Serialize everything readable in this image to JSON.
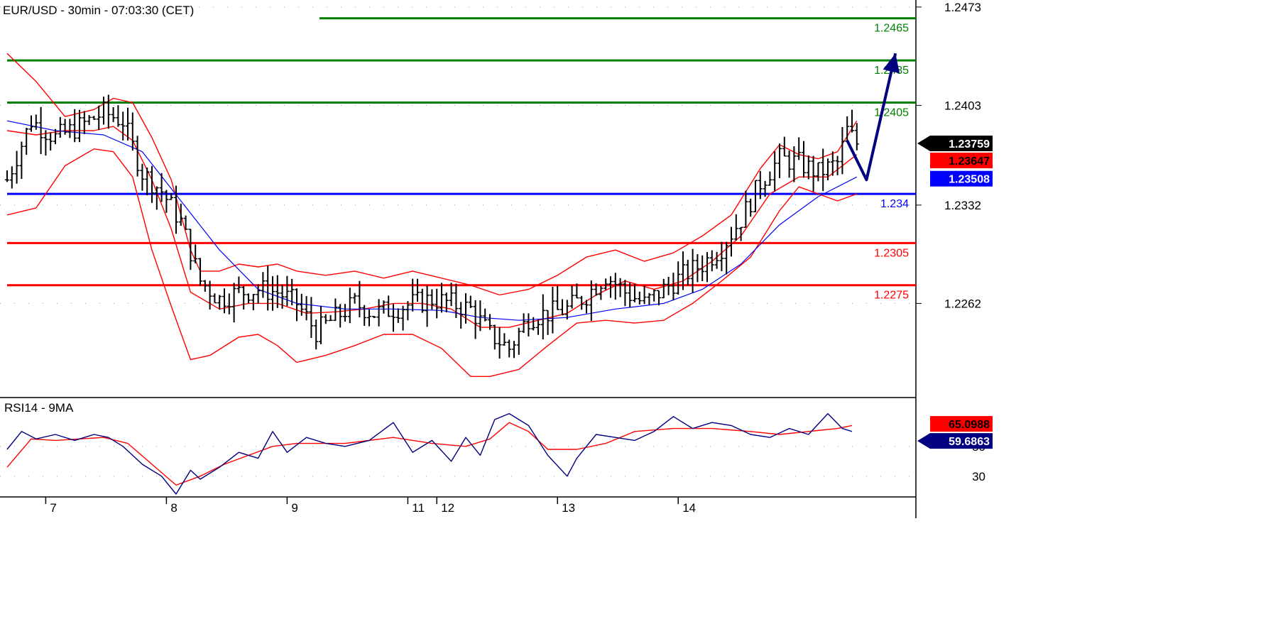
{
  "chart_data": [
    {
      "type": "candlestick",
      "title": "EUR/USD - 30min - 07:03:30 (CET)",
      "ylim": [
        1.2195,
        1.2478
      ],
      "yticks": [
        "1.2473",
        "1.2403",
        "1.2332",
        "1.2262"
      ],
      "x_ticks": [
        "7",
        "8",
        "9",
        "11",
        "12",
        "13",
        "14"
      ],
      "grid": true,
      "horizontal_levels": [
        {
          "value": 1.2465,
          "label": "1.2465",
          "color": "#008000"
        },
        {
          "value": 1.2435,
          "label": "1.2435",
          "color": "#008000"
        },
        {
          "value": 1.2405,
          "label": "1.2405",
          "color": "#008000"
        },
        {
          "value": 1.234,
          "label": "1.234",
          "color": "#0000ff"
        },
        {
          "value": 1.2305,
          "label": "1.2305",
          "color": "#ff0000"
        },
        {
          "value": 1.2275,
          "label": "1.2275",
          "color": "#ff0000"
        }
      ],
      "price_badges": [
        {
          "value": 1.23759,
          "label": "1.23759",
          "bg": "#000000",
          "fg": "#ffffff",
          "pointer": true
        },
        {
          "value": 1.23647,
          "label": "1.23647",
          "bg": "#ff0000",
          "fg": "#000000",
          "pointer": false
        },
        {
          "value": 1.23508,
          "label": "1.23508",
          "bg": "#0000ff",
          "fg": "#ffffff",
          "pointer": false
        }
      ],
      "close_path": [
        [
          0,
          1.235
        ],
        [
          5,
          1.2392
        ],
        [
          10,
          1.238
        ],
        [
          15,
          1.2388
        ],
        [
          20,
          1.2398
        ],
        [
          24,
          1.2392
        ],
        [
          28,
          1.2355
        ],
        [
          32,
          1.2342
        ],
        [
          36,
          1.232
        ],
        [
          40,
          1.2278
        ],
        [
          44,
          1.2265
        ],
        [
          48,
          1.227
        ],
        [
          52,
          1.2272
        ],
        [
          56,
          1.227
        ],
        [
          60,
          1.2262
        ],
        [
          64,
          1.2242
        ],
        [
          68,
          1.2252
        ],
        [
          72,
          1.2262
        ],
        [
          76,
          1.2255
        ],
        [
          80,
          1.2258
        ],
        [
          84,
          1.2262
        ],
        [
          88,
          1.2265
        ],
        [
          92,
          1.2262
        ],
        [
          96,
          1.2258
        ],
        [
          100,
          1.224
        ],
        [
          104,
          1.223
        ],
        [
          108,
          1.2252
        ],
        [
          112,
          1.2255
        ],
        [
          116,
          1.2258
        ],
        [
          120,
          1.2268
        ],
        [
          124,
          1.2282
        ],
        [
          128,
          1.227
        ],
        [
          132,
          1.2262
        ],
        [
          136,
          1.2272
        ],
        [
          140,
          1.2282
        ],
        [
          144,
          1.229
        ],
        [
          148,
          1.2302
        ],
        [
          152,
          1.2322
        ],
        [
          156,
          1.2348
        ],
        [
          160,
          1.2365
        ],
        [
          164,
          1.2362
        ],
        [
          168,
          1.2355
        ],
        [
          172,
          1.2362
        ],
        [
          174,
          1.2385
        ],
        [
          176,
          1.2376
        ]
      ],
      "bollinger_upper": [
        [
          0,
          1.244
        ],
        [
          6,
          1.242
        ],
        [
          12,
          1.2395
        ],
        [
          18,
          1.24
        ],
        [
          22,
          1.2408
        ],
        [
          26,
          1.2405
        ],
        [
          30,
          1.238
        ],
        [
          34,
          1.235
        ],
        [
          38,
          1.23
        ],
        [
          40,
          1.2285
        ],
        [
          44,
          1.2285
        ],
        [
          48,
          1.229
        ],
        [
          52,
          1.2288
        ],
        [
          56,
          1.229
        ],
        [
          60,
          1.2285
        ],
        [
          66,
          1.2282
        ],
        [
          72,
          1.2285
        ],
        [
          78,
          1.228
        ],
        [
          84,
          1.2285
        ],
        [
          90,
          1.228
        ],
        [
          96,
          1.2275
        ],
        [
          102,
          1.2268
        ],
        [
          108,
          1.2272
        ],
        [
          114,
          1.2282
        ],
        [
          120,
          1.2295
        ],
        [
          126,
          1.23
        ],
        [
          132,
          1.2292
        ],
        [
          138,
          1.2298
        ],
        [
          144,
          1.231
        ],
        [
          150,
          1.2325
        ],
        [
          156,
          1.2358
        ],
        [
          160,
          1.2375
        ],
        [
          164,
          1.2368
        ],
        [
          168,
          1.2365
        ],
        [
          172,
          1.237
        ],
        [
          176,
          1.2392
        ]
      ],
      "bollinger_lower": [
        [
          0,
          1.2325
        ],
        [
          6,
          1.233
        ],
        [
          12,
          1.236
        ],
        [
          18,
          1.2372
        ],
        [
          22,
          1.237
        ],
        [
          26,
          1.2352
        ],
        [
          30,
          1.23
        ],
        [
          34,
          1.226
        ],
        [
          38,
          1.2222
        ],
        [
          42,
          1.2225
        ],
        [
          48,
          1.2238
        ],
        [
          52,
          1.224
        ],
        [
          56,
          1.2232
        ],
        [
          60,
          1.222
        ],
        [
          66,
          1.2225
        ],
        [
          72,
          1.2232
        ],
        [
          78,
          1.224
        ],
        [
          84,
          1.224
        ],
        [
          90,
          1.223
        ],
        [
          96,
          1.221
        ],
        [
          100,
          1.221
        ],
        [
          106,
          1.2215
        ],
        [
          112,
          1.2232
        ],
        [
          118,
          1.2248
        ],
        [
          124,
          1.225
        ],
        [
          130,
          1.2248
        ],
        [
          136,
          1.225
        ],
        [
          142,
          1.2262
        ],
        [
          148,
          1.2278
        ],
        [
          154,
          1.2295
        ],
        [
          160,
          1.2328
        ],
        [
          164,
          1.2345
        ],
        [
          168,
          1.234
        ],
        [
          172,
          1.2335
        ],
        [
          176,
          1.234
        ]
      ],
      "bollinger_mid": [
        [
          0,
          1.2385
        ],
        [
          6,
          1.2382
        ],
        [
          12,
          1.2385
        ],
        [
          18,
          1.2385
        ],
        [
          22,
          1.2388
        ],
        [
          26,
          1.2378
        ],
        [
          30,
          1.235
        ],
        [
          34,
          1.2315
        ],
        [
          38,
          1.227
        ],
        [
          44,
          1.2258
        ],
        [
          50,
          1.2262
        ],
        [
          56,
          1.2262
        ],
        [
          62,
          1.2255
        ],
        [
          68,
          1.2256
        ],
        [
          74,
          1.2258
        ],
        [
          80,
          1.2262
        ],
        [
          86,
          1.2262
        ],
        [
          92,
          1.2258
        ],
        [
          98,
          1.2245
        ],
        [
          104,
          1.2245
        ],
        [
          110,
          1.225
        ],
        [
          116,
          1.2255
        ],
        [
          122,
          1.2268
        ],
        [
          128,
          1.2278
        ],
        [
          134,
          1.2272
        ],
        [
          140,
          1.2278
        ],
        [
          146,
          1.2292
        ],
        [
          152,
          1.231
        ],
        [
          158,
          1.234
        ],
        [
          164,
          1.2352
        ],
        [
          170,
          1.2352
        ],
        [
          176,
          1.2368
        ]
      ],
      "ma_blue": [
        [
          0,
          1.2392
        ],
        [
          10,
          1.2385
        ],
        [
          20,
          1.2382
        ],
        [
          28,
          1.237
        ],
        [
          36,
          1.2335
        ],
        [
          44,
          1.23
        ],
        [
          52,
          1.2272
        ],
        [
          60,
          1.2262
        ],
        [
          70,
          1.2258
        ],
        [
          80,
          1.2258
        ],
        [
          90,
          1.2257
        ],
        [
          98,
          1.2252
        ],
        [
          106,
          1.225
        ],
        [
          116,
          1.2252
        ],
        [
          126,
          1.2258
        ],
        [
          136,
          1.2262
        ],
        [
          144,
          1.2272
        ],
        [
          152,
          1.229
        ],
        [
          160,
          1.2318
        ],
        [
          168,
          1.2338
        ],
        [
          176,
          1.2352
        ]
      ],
      "forecast_arrow": [
        [
          174,
          1.2378
        ],
        [
          178,
          1.235
        ],
        [
          184,
          1.244
        ]
      ]
    },
    {
      "type": "line",
      "title": "RSI14 - 9MA",
      "ylim": [
        18,
        78
      ],
      "yticks": [
        "50",
        "30"
      ],
      "price_badges": [
        {
          "value": 65.0988,
          "label": "65.0988",
          "bg": "#ff0000",
          "fg": "#000000",
          "pointer": false
        },
        {
          "value": 59.6863,
          "label": "59.6863",
          "bg": "#000080",
          "fg": "#ffffff",
          "pointer": true
        }
      ],
      "series": [
        {
          "color": "#000080",
          "points": [
            [
              0,
              48
            ],
            [
              3,
              60
            ],
            [
              6,
              55
            ],
            [
              10,
              58
            ],
            [
              14,
              54
            ],
            [
              18,
              58
            ],
            [
              21,
              56
            ],
            [
              24,
              50
            ],
            [
              28,
              38
            ],
            [
              32,
              30
            ],
            [
              35,
              18
            ],
            [
              38,
              34
            ],
            [
              40,
              28
            ],
            [
              44,
              36
            ],
            [
              48,
              46
            ],
            [
              52,
              42
            ],
            [
              55,
              60
            ],
            [
              58,
              46
            ],
            [
              62,
              56
            ],
            [
              66,
              52
            ],
            [
              70,
              50
            ],
            [
              75,
              54
            ],
            [
              80,
              66
            ],
            [
              84,
              46
            ],
            [
              88,
              54
            ],
            [
              92,
              40
            ],
            [
              95,
              56
            ],
            [
              98,
              44
            ],
            [
              101,
              68
            ],
            [
              104,
              72
            ],
            [
              108,
              64
            ],
            [
              112,
              44
            ],
            [
              116,
              30
            ],
            [
              118,
              42
            ],
            [
              122,
              58
            ],
            [
              126,
              56
            ],
            [
              130,
              54
            ],
            [
              134,
              60
            ],
            [
              138,
              70
            ],
            [
              142,
              62
            ],
            [
              146,
              66
            ],
            [
              150,
              64
            ],
            [
              154,
              58
            ],
            [
              158,
              56
            ],
            [
              162,
              62
            ],
            [
              166,
              58
            ],
            [
              170,
              72
            ],
            [
              173,
              62
            ],
            [
              175,
              60
            ]
          ]
        },
        {
          "color": "#ff0000",
          "points": [
            [
              0,
              36
            ],
            [
              5,
              55
            ],
            [
              10,
              54
            ],
            [
              15,
              55
            ],
            [
              20,
              56
            ],
            [
              25,
              52
            ],
            [
              30,
              38
            ],
            [
              35,
              24
            ],
            [
              40,
              30
            ],
            [
              45,
              38
            ],
            [
              50,
              44
            ],
            [
              55,
              50
            ],
            [
              60,
              52
            ],
            [
              70,
              52
            ],
            [
              80,
              56
            ],
            [
              88,
              52
            ],
            [
              95,
              50
            ],
            [
              100,
              55
            ],
            [
              104,
              66
            ],
            [
              108,
              60
            ],
            [
              112,
              48
            ],
            [
              118,
              48
            ],
            [
              124,
              52
            ],
            [
              130,
              60
            ],
            [
              138,
              62
            ],
            [
              146,
              62
            ],
            [
              154,
              60
            ],
            [
              160,
              58
            ],
            [
              166,
              60
            ],
            [
              172,
              62
            ],
            [
              175,
              64
            ]
          ]
        }
      ]
    }
  ]
}
